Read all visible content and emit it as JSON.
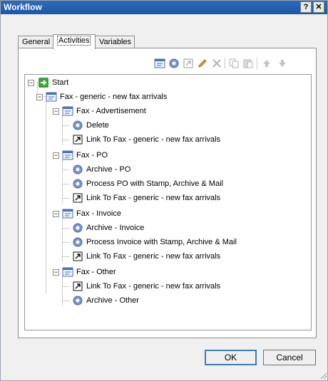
{
  "window": {
    "title": "Workflow",
    "help_label": "?",
    "close_label": "✕"
  },
  "tabs": [
    {
      "label": "General"
    },
    {
      "label": "Activities"
    },
    {
      "label": "Variables"
    }
  ],
  "tree": {
    "start": "Start",
    "group": "Fax - generic - new fax arrivals",
    "advertisement": {
      "label": "Fax - Advertisement",
      "items": [
        "Delete",
        "Link To Fax - generic - new fax arrivals"
      ]
    },
    "po": {
      "label": "Fax - PO",
      "items": [
        "Archive - PO",
        "Process PO with Stamp, Archive & Mail",
        "Link To Fax - generic - new fax arrivals"
      ]
    },
    "invoice": {
      "label": "Fax - Invoice",
      "items": [
        "Archive - Invoice",
        "Process Invoice with Stamp, Archive & Mail",
        "Link To Fax - generic - new fax arrivals"
      ]
    },
    "other": {
      "label": "Fax - Other",
      "items": [
        "Link To Fax - generic - new fax arrivals",
        "Archive - Other"
      ]
    }
  },
  "buttons": {
    "ok": "OK",
    "cancel": "Cancel"
  },
  "colors": {
    "title_bar": "#1e56a4",
    "start_green": "#3aa33a",
    "gear_blue": "#6f86c8"
  }
}
